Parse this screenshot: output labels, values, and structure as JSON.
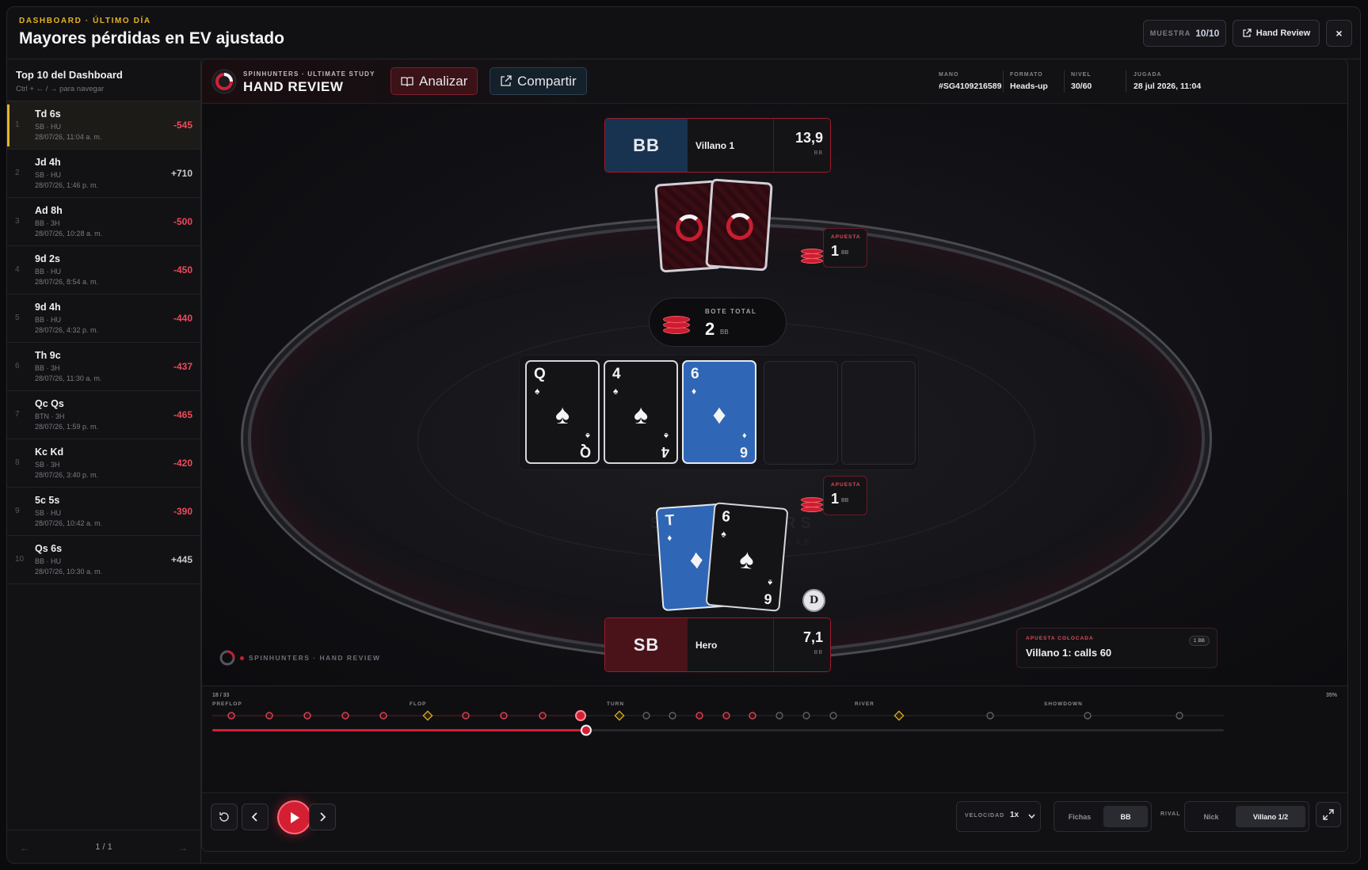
{
  "header": {
    "eyebrow": "DASHBOARD · ÚLTIMO DÍA",
    "title": "Mayores pérdidas en EV ajustado",
    "muestra_label": "MUESTRA",
    "muestra_value": "10/10",
    "hand_review_label": "Hand Review",
    "close_icon": "×"
  },
  "sidebar": {
    "title": "Top 10 del Dashboard",
    "hint": "Ctrl + ← / → para navegar",
    "items": [
      {
        "idx": "1",
        "hand": "Td 6s",
        "sub": "SB · HU",
        "date": "28/07/26, 11:04 a. m.",
        "value": "-545",
        "type": "neg"
      },
      {
        "idx": "2",
        "hand": "Jd 4h",
        "sub": "SB · HU",
        "date": "28/07/26, 1:46 p. m.",
        "value": "+710",
        "type": "pos"
      },
      {
        "idx": "3",
        "hand": "Ad 8h",
        "sub": "BB · 3H",
        "date": "28/07/26, 10:28 a. m.",
        "value": "-500",
        "type": "neg"
      },
      {
        "idx": "4",
        "hand": "9d 2s",
        "sub": "BB · HU",
        "date": "28/07/26, 8:54 a. m.",
        "value": "-450",
        "type": "neg"
      },
      {
        "idx": "5",
        "hand": "9d 4h",
        "sub": "BB · HU",
        "date": "28/07/26, 4:32 p. m.",
        "value": "-440",
        "type": "neg"
      },
      {
        "idx": "6",
        "hand": "Th 9c",
        "sub": "BB · 3H",
        "date": "28/07/26, 11:30 a. m.",
        "value": "-437",
        "type": "neg"
      },
      {
        "idx": "7",
        "hand": "Qc Qs",
        "sub": "BTN · 3H",
        "date": "28/07/26, 1:59 p. m.",
        "value": "-465",
        "type": "neg"
      },
      {
        "idx": "8",
        "hand": "Kc Kd",
        "sub": "SB · 3H",
        "date": "28/07/26, 3:40 p. m.",
        "value": "-420",
        "type": "neg"
      },
      {
        "idx": "9",
        "hand": "5c 5s",
        "sub": "SB · HU",
        "date": "28/07/26, 10:42 a. m.",
        "value": "-390",
        "type": "neg"
      },
      {
        "idx": "10",
        "hand": "Qs 6s",
        "sub": "BB · HU",
        "date": "28/07/26, 10:30 a. m.",
        "value": "+445",
        "type": "pos"
      }
    ],
    "page": "1 / 1"
  },
  "toolbar": {
    "brand_top": "SPINHUNTERS · ULTIMATE STUDY",
    "brand_main": "HAND REVIEW",
    "analizar_label": "Analizar",
    "compartir_label": "Compartir",
    "meta": [
      {
        "k": "MANO",
        "v": "#SG4109216589"
      },
      {
        "k": "FORMATO",
        "v": "Heads-up"
      },
      {
        "k": "NIVEL",
        "v": "30/60"
      },
      {
        "k": "JUGADA",
        "v": "28 jul 2026, 11:04"
      }
    ]
  },
  "table": {
    "watermark": "SPINHUNTERS",
    "watermark_sub": "ULTIMATE · REPLAY LAB",
    "villain": {
      "pos": "BB",
      "name": "Villano 1",
      "stack": "13,9",
      "unit": "BB"
    },
    "hero": {
      "pos": "SB",
      "name": "Hero",
      "stack": "7,1",
      "unit": "BB"
    },
    "villain_bet": {
      "label": "APUESTA",
      "value": "1",
      "unit": "BB"
    },
    "hero_bet": {
      "label": "APUESTA",
      "value": "1",
      "unit": "BB"
    },
    "pot": {
      "label": "BOTE TOTAL",
      "value": "2",
      "unit": "BB"
    },
    "board": [
      {
        "rank": "Q",
        "suit": "♠",
        "color": "dark"
      },
      {
        "rank": "4",
        "suit": "♠",
        "color": "dark"
      },
      {
        "rank": "6",
        "suit": "♦",
        "color": "blue"
      }
    ],
    "hero_cards": [
      {
        "rank": "T",
        "suit": "♦",
        "color": "blue"
      },
      {
        "rank": "6",
        "suit": "♠",
        "color": "dark"
      }
    ],
    "dealer": "D",
    "corner_brand": "SPINHUNTERS · HAND REVIEW",
    "last_action": {
      "label": "APUESTA COLOCADA",
      "text": "Villano 1: calls 60",
      "badge": "1 BB"
    }
  },
  "timeline": {
    "count": "18 / 33",
    "percent": "35%",
    "streets": [
      "PREFLOP",
      "FLOP",
      "TURN",
      "RIVER",
      "SHOWDOWN"
    ],
    "progress": 0.35
  },
  "controls": {
    "speed_label": "VELOCIDAD",
    "speed_value": "1x",
    "fichas_label": "Fichas",
    "bb_label": "BB",
    "rival_label": "RIVAL",
    "nick_label": "Nick",
    "villano_label": "Villano 1/2"
  },
  "colors": {
    "accent": "#d41f33",
    "gold": "#e6b422",
    "blue": "#2f66b5"
  }
}
